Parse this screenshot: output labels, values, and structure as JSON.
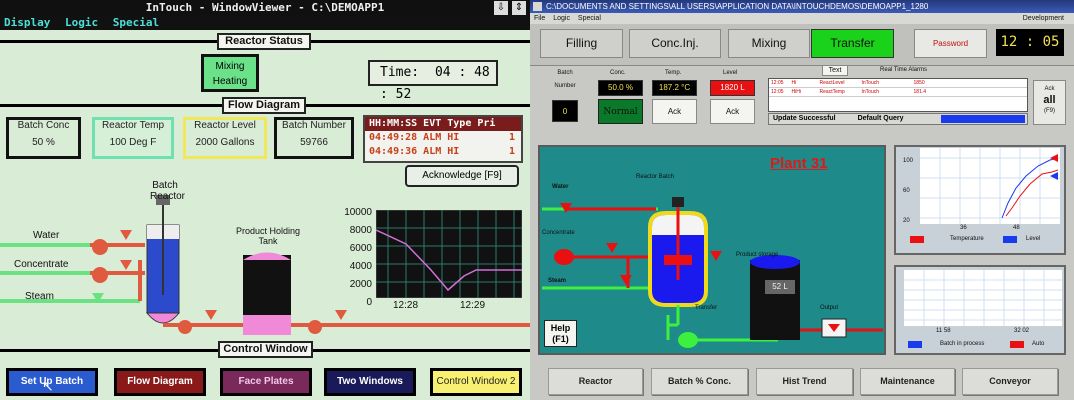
{
  "left": {
    "title": "InTouch - WindowViewer - C:\\DEMOAPP1",
    "menu": [
      "Display",
      "Logic",
      "Special"
    ],
    "reactor_status": "Reactor Status",
    "mixing": "Mixing",
    "heating": "Heating",
    "time_label": "Time:",
    "time_value": "04 : 48 : 52",
    "flow_diagram": "Flow Diagram",
    "batch_conc_label": "Batch Conc",
    "batch_conc_value": "50 %",
    "reactor_temp_label": "Reactor Temp",
    "reactor_temp_value": "100 Deg F",
    "reactor_level_label": "Reactor Level",
    "reactor_level_value": "2000 Gallons",
    "batch_number_label": "Batch Number",
    "batch_number_value": "59766",
    "alarm_header": "HH:MM:SS EVT Type Pri",
    "alarms": [
      {
        "text": "04:49:28 ALM HI",
        "pri": "1"
      },
      {
        "text": "04:49:36 ALM HI",
        "pri": "1"
      }
    ],
    "ack": "Acknowledge [F9]",
    "batch_reactor": "Batch",
    "batch_reactor2": "Reactor",
    "water": "Water",
    "concentrate": "Concentrate",
    "steam": "Steam",
    "product_holding": "Product Holding",
    "tank": "Tank",
    "trend_y": [
      "10000",
      "8000",
      "6000",
      "4000",
      "2000",
      "0"
    ],
    "trend_x": [
      "12:28",
      "12:29"
    ],
    "control_window": "Control Window",
    "buttons": [
      "Set Up Batch",
      "Flow Diagram",
      "Face Plates",
      "Two Windows",
      "Control Window 2"
    ]
  },
  "right": {
    "title": "C:\\DOCUMENTS AND SETTINGS\\ALL USERS\\APPLICATION DATA\\INTOUCHDEMOS\\DEMOAPP1_1280",
    "develop": "Development",
    "menu": [
      "File",
      "Logic",
      "Special"
    ],
    "tabs": [
      "Filling",
      "Conc.Inj.",
      "Mixing",
      "Transfer"
    ],
    "password": "Password",
    "clock": "12 : 05",
    "batch_label": "Batch",
    "number_label": "Number",
    "batch_value": "0",
    "conc_label": "Conc.",
    "conc_value": "50.0 %",
    "normal": "Normal",
    "temp_label": "Temp.",
    "temp_value": "187.2 °C",
    "ack": "Ack",
    "level_label": "Level",
    "level_value": "1820 L",
    "text_btn": "Text",
    "rta": "Real Time Alarms",
    "alarm_rows": [
      [
        "12:05",
        "Hi",
        "ReactLevel",
        "InTouch",
        "1850"
      ],
      [
        "12:05",
        "HiHi",
        "ReactTemp",
        "InTouch",
        "181.4"
      ]
    ],
    "update": "Update Successful",
    "default_query": "Default Query",
    "ack_all1": "Ack",
    "ack_all2": "all",
    "ack_all3": "(F9)",
    "plant": "Plant 31",
    "water": "Water",
    "concentrate": "Concentrate",
    "steam": "Steam",
    "reactor_batch": "Reactor Batch",
    "product_storage": "Product storage",
    "storage_value": "52 L",
    "transfer": "Transfer",
    "output": "Output",
    "help1": "Help",
    "help2": "(F1)",
    "trend1_y": [
      "100",
      "60",
      "20"
    ],
    "trend1_x": [
      "36",
      "48"
    ],
    "legend1": [
      "Temperature",
      "Level"
    ],
    "trend2_x": [
      "11 58",
      "32 02"
    ],
    "legend2": [
      "Batch in process",
      "Auto"
    ],
    "nav": [
      "Reactor",
      "Batch % Conc.",
      "Hist Trend",
      "Maintenance",
      "Conveyor"
    ]
  }
}
